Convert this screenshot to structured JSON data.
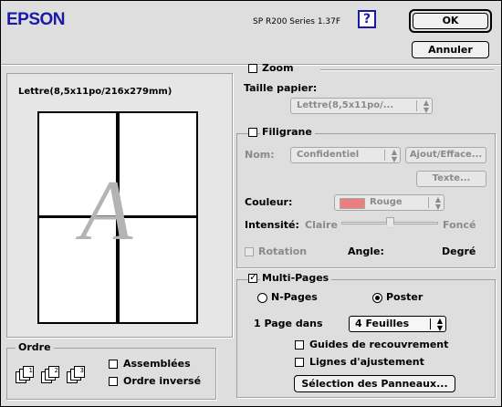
{
  "header": {
    "brand": "EPSON",
    "version": "SP R200 Series 1.37F",
    "help_label": "?",
    "ok_label": "OK",
    "cancel_label": "Annuler"
  },
  "preview": {
    "paper_caption": "Lettre(8,5x11po/216x279mm)",
    "watermark_letter": "A"
  },
  "order": {
    "title": "Ordre",
    "collated_label": "Assemblées",
    "collated_checked": false,
    "reverse_label": "Ordre inversé",
    "reverse_checked": false,
    "icon_numbers": [
      "1",
      "2",
      "3"
    ]
  },
  "zoom": {
    "label": "Zoom",
    "checked": false,
    "paper_size_label": "Taille papier:",
    "paper_size_value": "Lettre(8,5x11po/..."
  },
  "watermark": {
    "label": "Filigrane",
    "checked": false,
    "name_label": "Nom:",
    "name_value": "Confidentiel",
    "add_delete_label": "Ajout/Efface...",
    "text_label": "Texte...",
    "color_label": "Couleur:",
    "color_value": "Rouge",
    "color_swatch": "#e88080",
    "intensity_label": "Intensité:",
    "intensity_low": "Claire",
    "intensity_high": "Foncé",
    "intensity_level": 0.5,
    "rotation_label": "Rotation",
    "angle_label": "Angle:",
    "degree_label": "Degré"
  },
  "multipage": {
    "label": "Multi-Pages",
    "checked": true,
    "npages_label": "N-Pages",
    "npages_selected": false,
    "poster_label": "Poster",
    "poster_selected": true,
    "page_in_label": "1 Page dans",
    "sheets_value": "4 Feuilles",
    "overlap_guides_label": "Guides de recouvrement",
    "overlap_guides_checked": false,
    "trim_lines_label": "Lignes d'ajustement",
    "trim_lines_checked": false,
    "panel_select_label": "Sélection des Panneaux..."
  }
}
